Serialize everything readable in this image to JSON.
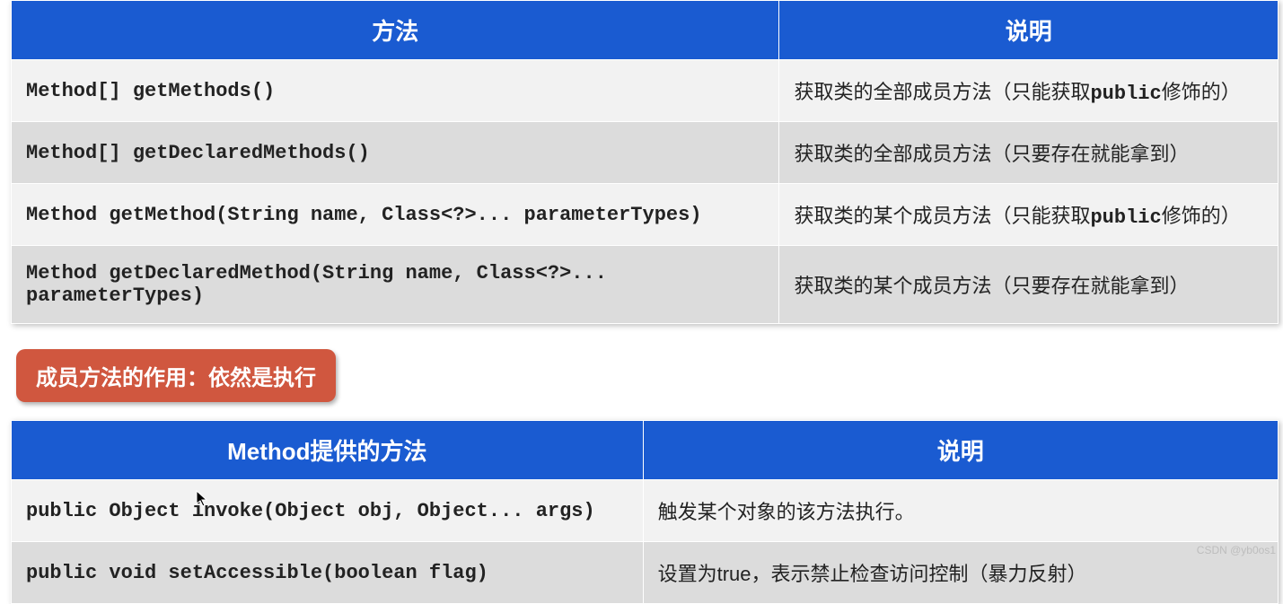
{
  "table1": {
    "headers": [
      "方法",
      "说明"
    ],
    "rows": [
      {
        "method": "Method[] getMethods()",
        "desc_pre": "获取类的全部成员方法（只能获取",
        "desc_mono": "public",
        "desc_post": "修饰的）"
      },
      {
        "method": "Method[] getDeclaredMethods()",
        "desc_pre": "获取类的全部成员方法（只要存在就能拿到）",
        "desc_mono": "",
        "desc_post": ""
      },
      {
        "method": "Method getMethod(String name, Class<?>... parameterTypes)",
        "desc_pre": "获取类的某个成员方法（只能获取",
        "desc_mono": "public",
        "desc_post": "修饰的）"
      },
      {
        "method": "Method getDeclaredMethod(String name, Class<?>... parameterTypes)",
        "desc_pre": "获取类的某个成员方法（只要存在就能拿到）",
        "desc_mono": "",
        "desc_post": ""
      }
    ]
  },
  "pill_label": "成员方法的作用：依然是执行",
  "table2": {
    "headers": [
      "Method提供的方法",
      "说明"
    ],
    "rows": [
      {
        "method": "public Object invoke(Object obj, Object... args)",
        "desc": "触发某个对象的该方法执行。"
      },
      {
        "method": "public void  setAccessible(boolean flag)",
        "desc": "设置为true，表示禁止检查访问控制（暴力反射）"
      }
    ]
  },
  "watermark": "CSDN @yb0os1"
}
